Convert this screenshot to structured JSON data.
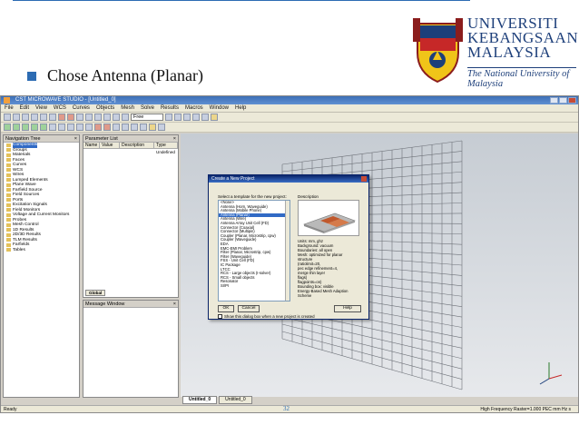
{
  "header": {
    "university_lines": [
      "UNIVERSITI",
      "KEBANGSAAN",
      "MALAYSIA"
    ],
    "tagline": "The National University of Malaysia",
    "bullet": "Chose Antenna (Planar)"
  },
  "app": {
    "title": "CST MICROWAVE STUDIO - [Untitled_0]",
    "menu": [
      "File",
      "Edit",
      "View",
      "WCS",
      "Curves",
      "Objects",
      "Mesh",
      "Solve",
      "Results",
      "Macros",
      "Window",
      "Help"
    ],
    "toolbar_select": "Free"
  },
  "nav_tree": {
    "title": "Navigation Tree",
    "items": [
      "Components",
      "Groups",
      "Materials",
      "Faces",
      "Curves",
      "WCS",
      "Wires",
      "Lumped Elements",
      "Plane Wave",
      "Farfield Source",
      "Field Sources",
      "Ports",
      "Excitation Signals",
      "Field Monitors",
      "Voltage and Current Monitors",
      "Probes",
      "Mesh Control",
      "1D Results",
      "2D/3D Results",
      "TLM Results",
      "Farfields",
      "Tables"
    ],
    "selected_index": 0
  },
  "param_list": {
    "title": "Parameter List",
    "columns": [
      "Name",
      "Value",
      "Description",
      "Type"
    ],
    "type_value": "Undefined",
    "tab": "Global"
  },
  "message_window": {
    "title": "Message Window"
  },
  "dialog": {
    "title": "Create a New Project",
    "select_label": "Select a template for the new project:",
    "desc_label": "Description",
    "templates": [
      "<None>",
      "Antenna (Horn, Waveguide)",
      "Antenna (Mobile Phone)",
      "Antenna (Planar)",
      "Antenna (Wire)",
      "Antenna Array Unit Cell (FD)",
      "Connector (Coaxial)",
      "Connector (Multipin)",
      "Coupler (Planar, Microstrip, cpw)",
      "Coupler (Waveguide)",
      "EDA",
      "EMC-EMI Problem",
      "Filter (Planar, Microstrip, cpw)",
      "Filter (Waveguide)",
      "FSS - Unit Cell (FD)",
      "IC Package",
      "LTCC",
      "RCS - Large objects (I-solver)",
      "RCS - Small objects",
      "Resonator",
      "SI/PI"
    ],
    "selected_index": 3,
    "description": [
      "Units: mm, ghz",
      "Background: vacuum",
      "Boundaries: all open",
      "Mesh: optimized for planar",
      "structure",
      "  (ratiolimit=20,",
      "   pec edge refinement=4,",
      "   merge thin layer",
      "  flags)",
      "flagpoints=on)",
      "Bounding box: visible",
      "Energy-Based Mesh Adaption",
      "Scheme"
    ],
    "checkbox_label": "Show this dialog box when a new project is created",
    "ok": "OK",
    "cancel": "Cancel",
    "help": "Help"
  },
  "tabs": [
    "Untitled_0",
    "Untitled_0"
  ],
  "status": {
    "left": "Ready",
    "right": "High Frequency   Raster=1.000   PEC   mm   Hz   s"
  },
  "page_number": "32",
  "colors": {
    "accent": "#2d6cb3",
    "selection": "#316ac5"
  }
}
